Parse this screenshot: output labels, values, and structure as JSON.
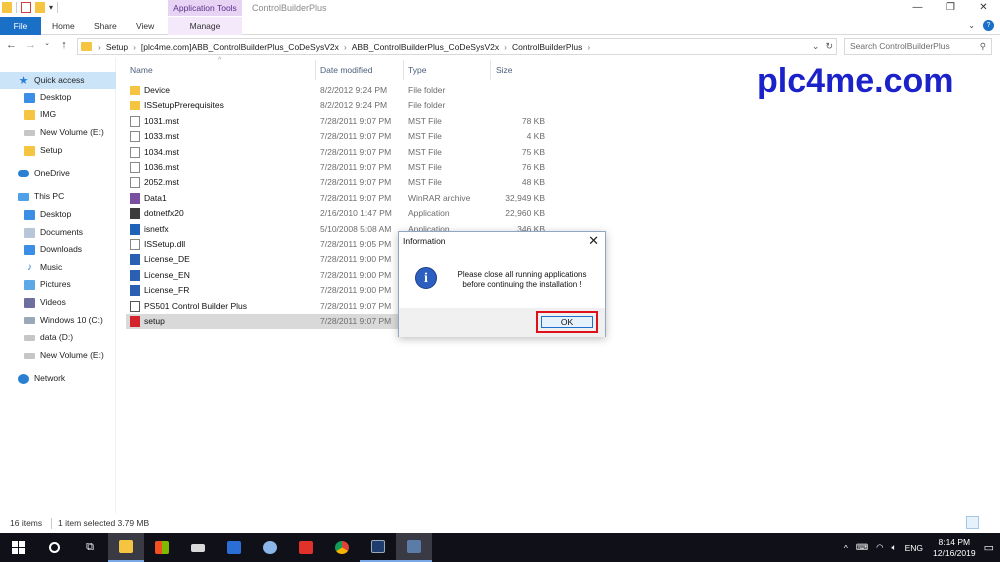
{
  "window": {
    "title": "ControlBuilderPlus",
    "context_tab_group": "Application Tools",
    "controls": [
      "minimize",
      "restore",
      "close"
    ]
  },
  "ribbon": {
    "tabs": [
      "File",
      "Home",
      "Share",
      "View",
      "Manage"
    ],
    "active_tab": "Manage",
    "accent": "#1a6fc7",
    "context_color": "#e7d4f5"
  },
  "address": {
    "crumbs": [
      "Setup",
      "[plc4me.com]ABB_ControlBuilderPlus_CoDeSysV2x",
      "ABB_ControlBuilderPlus_CoDeSysV2x",
      "ControlBuilderPlus"
    ],
    "search_placeholder": "Search ControlBuilderPlus"
  },
  "nav": {
    "items": [
      {
        "label": "Quick access",
        "icon": "star-icon",
        "level": 0,
        "selected": true
      },
      {
        "label": "Desktop",
        "icon": "desktop-icon",
        "level": 1
      },
      {
        "label": "IMG",
        "icon": "folder-icon",
        "level": 1
      },
      {
        "label": "New Volume (E:)",
        "icon": "drive-icon",
        "level": 1
      },
      {
        "label": "Setup",
        "icon": "folder-icon",
        "level": 1
      },
      {
        "label": "OneDrive",
        "icon": "cloud-icon",
        "level": 0
      },
      {
        "label": "This PC",
        "icon": "pc-icon",
        "level": 0
      },
      {
        "label": "Desktop",
        "icon": "desktop-icon",
        "level": 1
      },
      {
        "label": "Documents",
        "icon": "documents-icon",
        "level": 1
      },
      {
        "label": "Downloads",
        "icon": "downloads-icon",
        "level": 1
      },
      {
        "label": "Music",
        "icon": "music-icon",
        "level": 1
      },
      {
        "label": "Pictures",
        "icon": "pictures-icon",
        "level": 1
      },
      {
        "label": "Videos",
        "icon": "videos-icon",
        "level": 1
      },
      {
        "label": "Windows 10 (C:)",
        "icon": "windows-drive-icon",
        "level": 1
      },
      {
        "label": "data (D:)",
        "icon": "drive-icon",
        "level": 1
      },
      {
        "label": "New Volume (E:)",
        "icon": "drive-icon",
        "level": 1
      },
      {
        "label": "Network",
        "icon": "network-icon",
        "level": 0
      }
    ]
  },
  "columns": {
    "name": "Name",
    "date": "Date modified",
    "type": "Type",
    "size": "Size"
  },
  "files": [
    {
      "name": "Device",
      "date": "8/2/2012 9:24 PM",
      "type": "File folder",
      "size": "",
      "icon": "folder"
    },
    {
      "name": "ISSetupPrerequisites",
      "date": "8/2/2012 9:24 PM",
      "type": "File folder",
      "size": "",
      "icon": "folder"
    },
    {
      "name": "1031.mst",
      "date": "7/28/2011 9:07 PM",
      "type": "MST File",
      "size": "78 KB",
      "icon": "mst"
    },
    {
      "name": "1033.mst",
      "date": "7/28/2011 9:07 PM",
      "type": "MST File",
      "size": "4 KB",
      "icon": "mst"
    },
    {
      "name": "1034.mst",
      "date": "7/28/2011 9:07 PM",
      "type": "MST File",
      "size": "75 KB",
      "icon": "mst"
    },
    {
      "name": "1036.mst",
      "date": "7/28/2011 9:07 PM",
      "type": "MST File",
      "size": "76 KB",
      "icon": "mst"
    },
    {
      "name": "2052.mst",
      "date": "7/28/2011 9:07 PM",
      "type": "MST File",
      "size": "48 KB",
      "icon": "mst"
    },
    {
      "name": "Data1",
      "date": "7/28/2011 9:07 PM",
      "type": "WinRAR archive",
      "size": "32,949 KB",
      "icon": "rar"
    },
    {
      "name": "dotnetfx20",
      "date": "2/16/2010 1:47 PM",
      "type": "Application",
      "size": "22,960 KB",
      "icon": "exe"
    },
    {
      "name": "isnetfx",
      "date": "5/10/2008 5:08 AM",
      "type": "Application",
      "size": "346 KB",
      "icon": "isnet"
    },
    {
      "name": "ISSetup.dll",
      "date": "7/28/2011 9:05 PM",
      "type": "",
      "size": "",
      "icon": "dll"
    },
    {
      "name": "License_DE",
      "date": "7/28/2011 9:00 PM",
      "type": "",
      "size": "",
      "icon": "word"
    },
    {
      "name": "License_EN",
      "date": "7/28/2011 9:00 PM",
      "type": "",
      "size": "",
      "icon": "word"
    },
    {
      "name": "License_FR",
      "date": "7/28/2011 9:00 PM",
      "type": "",
      "size": "",
      "icon": "word"
    },
    {
      "name": "PS501 Control Builder Plus",
      "date": "7/28/2011 9:07 PM",
      "type": "",
      "size": "",
      "icon": "ps"
    },
    {
      "name": "setup",
      "date": "7/28/2011 9:07 PM",
      "type": "",
      "size": "",
      "icon": "setup",
      "selected": true
    }
  ],
  "watermark": "plc4me.com",
  "dialog": {
    "title": "Information",
    "message_line1": "Please close all running applications",
    "message_line2": "before continuing the installation !",
    "ok_label": "OK",
    "highlight_color": "#e0101b"
  },
  "status": {
    "item_count": "16 items",
    "selection": "1 item selected  3.79 MB"
  },
  "taskbar": {
    "lang": "ENG",
    "time": "8:14 PM",
    "date": "12/16/2019"
  }
}
